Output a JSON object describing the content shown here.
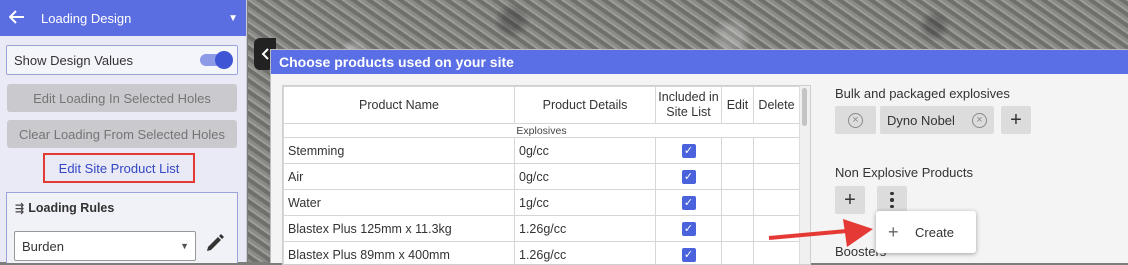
{
  "sidebar": {
    "title": "Loading Design",
    "toggle_label": "Show Design Values",
    "toggle_on": true,
    "btn_edit_loading": "Edit Loading In Selected Holes",
    "btn_clear_loading": "Clear Loading From Selected Holes",
    "link_edit_site": "Edit Site Product List",
    "loading_rules_title": "Loading Rules",
    "rule_select_value": "Burden"
  },
  "modal": {
    "title": "Choose products used on your site",
    "table": {
      "headers": [
        "Product Name",
        "Product Details",
        "Included in Site List",
        "Edit",
        "Delete"
      ],
      "group_label": "Explosives",
      "rows": [
        {
          "name": "Stemming",
          "details": "0g/cc",
          "included": true
        },
        {
          "name": "Air",
          "details": "0g/cc",
          "included": true
        },
        {
          "name": "Water",
          "details": "1g/cc",
          "included": true
        },
        {
          "name": "Blastex Plus 125mm x 11.3kg",
          "details": "1.26g/cc",
          "included": true
        },
        {
          "name": "Blastex Plus 89mm x 400mm",
          "details": "1.26g/cc",
          "included": true
        }
      ]
    },
    "bulk_label": "Bulk and packaged explosives",
    "chip_dyno": "Dyno Nobel",
    "non_explosive_label": "Non Explosive Products",
    "menu_create": "Create",
    "boosters_label": "Boosters",
    "accent": "#5a6fe6",
    "highlight": "#e53935"
  }
}
